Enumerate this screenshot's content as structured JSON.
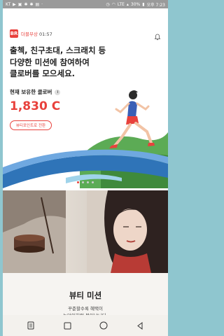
{
  "status_bar": {
    "carrier": "KT",
    "left_icons": [
      "play-icon",
      "image-icon",
      "notification-icon",
      "notification-icon",
      "box-icon",
      "more-icon"
    ],
    "network": "LTE",
    "battery": "30%",
    "time": "오후 7:23"
  },
  "app_bar": {
    "logo": "BR",
    "timer_label": "더블부상",
    "timer_value": "01:57",
    "bell_icon": "bell-icon"
  },
  "hero": {
    "headline": "출첵, 친구초대, 스크래치 등\n다양한 미션에 참여하여\n클로버를 모으세요.",
    "holding_label": "현재 보유한 클로버",
    "info_icon": "i",
    "amount": "1,830 C",
    "button_label": "뷰티포인트로 전환",
    "carousel_dots": 4,
    "carousel_active": 0
  },
  "mission": {
    "title": "뷰티 미션",
    "description": "꾸준할수록 혜택이\n눈덩이처럼 불어납니다."
  },
  "nav": [
    "recent-apps-icon",
    "square-icon",
    "home-icon",
    "back-icon"
  ],
  "colors": {
    "accent": "#e8413c",
    "background_frame": "#8fc6cf"
  }
}
